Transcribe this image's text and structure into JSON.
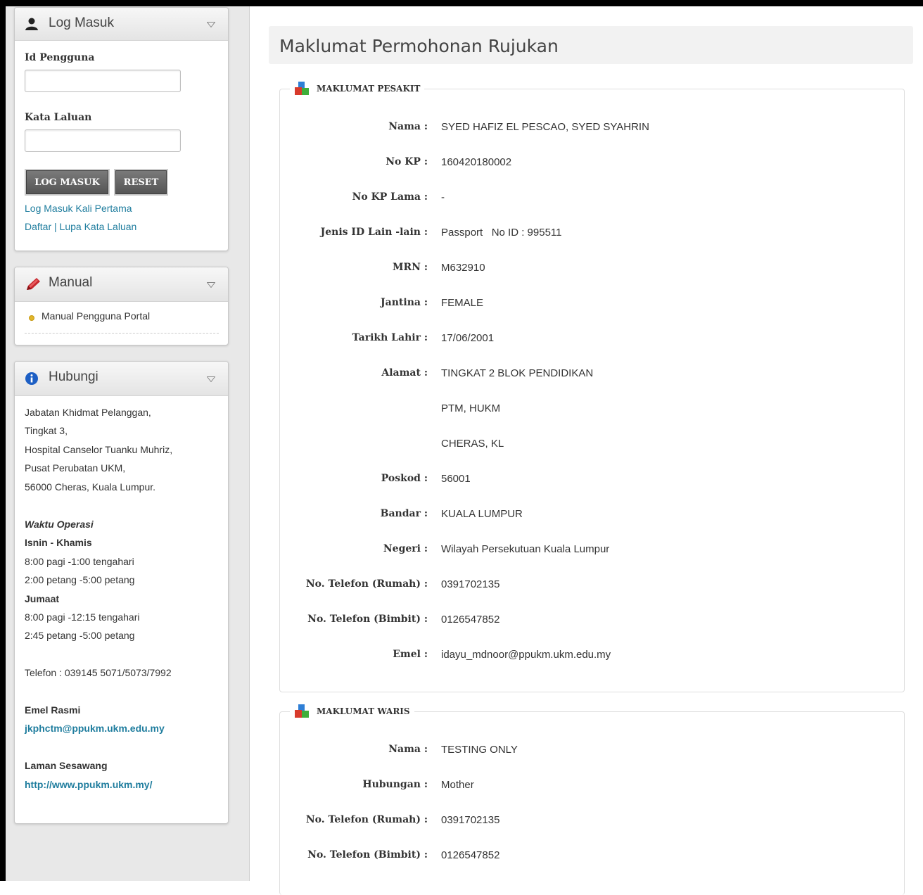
{
  "sidebar": {
    "login": {
      "title": "Log Masuk",
      "user_id_label": "Id Pengguna",
      "user_id_value": "",
      "password_label": "Kata Laluan",
      "password_value": "",
      "login_button": "LOG MASUK",
      "reset_button": "RESET",
      "first_login_link": "Log Masuk Kali Pertama",
      "register_link": "Daftar",
      "separator": "|",
      "forgot_link": "Lupa Kata Laluan"
    },
    "manual": {
      "title": "Manual",
      "items": [
        "Manual Pengguna Portal"
      ]
    },
    "contact": {
      "title": "Hubungi",
      "address": [
        "Jabatan Khidmat Pelanggan,",
        "Tingkat 3,",
        "Hospital Canselor Tuanku Muhriz,",
        "Pusat Perubatan UKM,",
        "56000 Cheras, Kuala Lumpur."
      ],
      "hours_title": "Waktu Operasi",
      "weekdays_label": "Isnin - Khamis",
      "weekday_hours": [
        "8:00 pagi -1:00 tengahari",
        "2:00 petang -5:00 petang"
      ],
      "friday_label": "Jumaat",
      "friday_hours": [
        "8:00 pagi -12:15 tengahari",
        "2:45 petang -5:00 petang"
      ],
      "phone": "Telefon : 039145 5071/5073/7992",
      "email_label": "Emel Rasmi",
      "email": "jkphctm@ppukm.ukm.edu.my",
      "website_label": "Laman Sesawang",
      "website": "http://www.ppukm.ukm.my/"
    }
  },
  "main": {
    "title": "Maklumat Permohonan Rujukan",
    "patient": {
      "legend": "MAKLUMAT PESAKIT",
      "rows": [
        {
          "label": "Nama :",
          "value": "SYED HAFIZ EL PESCAO, SYED SYAHRIN"
        },
        {
          "label": "No KP :",
          "value": "160420180002"
        },
        {
          "label": "No KP Lama :",
          "value": "-"
        },
        {
          "label": "Jenis ID Lain -lain :",
          "value": "Passport   No ID : 995511"
        },
        {
          "label": "MRN :",
          "value": "M632910"
        },
        {
          "label": "Jantina :",
          "value": "FEMALE"
        },
        {
          "label": "Tarikh Lahir :",
          "value": "17/06/2001"
        },
        {
          "label": "Alamat :",
          "value": "TINGKAT 2 BLOK PENDIDIKAN"
        },
        {
          "label": "",
          "value": "PTM, HUKM"
        },
        {
          "label": "",
          "value": "CHERAS, KL"
        },
        {
          "label": "Poskod :",
          "value": "56001"
        },
        {
          "label": "Bandar :",
          "value": "KUALA LUMPUR"
        },
        {
          "label": "Negeri :",
          "value": "Wilayah Persekutuan Kuala Lumpur"
        },
        {
          "label": "No. Telefon (Rumah) :",
          "value": "0391702135"
        },
        {
          "label": "No. Telefon (Bimbit) :",
          "value": "0126547852"
        },
        {
          "label": "Emel :",
          "value": "idayu_mdnoor@ppukm.ukm.edu.my"
        }
      ]
    },
    "guardian": {
      "legend": "MAKLUMAT WARIS",
      "rows": [
        {
          "label": "Nama :",
          "value": "TESTING ONLY"
        },
        {
          "label": "Hubungan :",
          "value": "Mother"
        },
        {
          "label": "No. Telefon (Rumah) :",
          "value": "0391702135"
        },
        {
          "label": "No. Telefon (Bimbit) :",
          "value": "0126547852"
        }
      ]
    }
  },
  "colors": {
    "link": "#1f7d9e",
    "button": "#555555",
    "sidebar_bg": "#e8e8e8"
  }
}
